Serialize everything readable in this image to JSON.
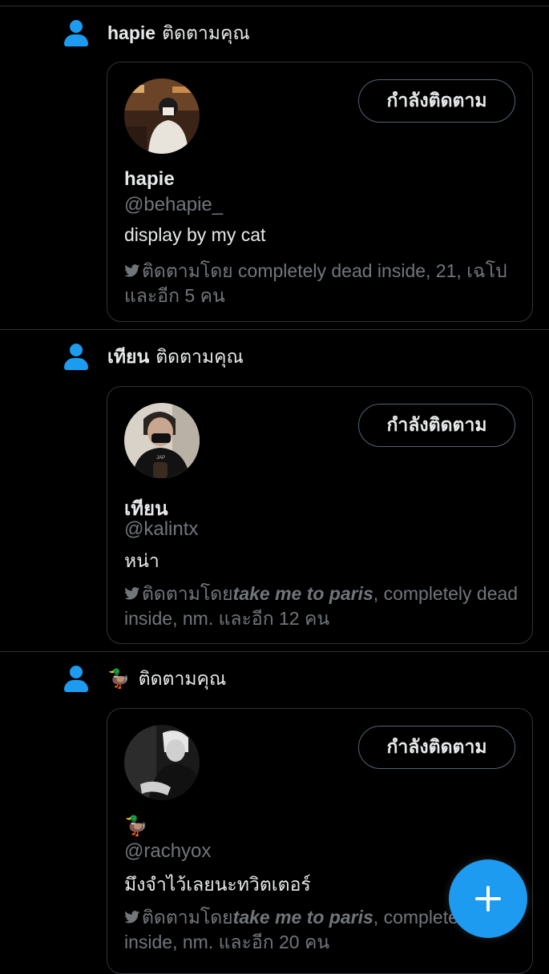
{
  "notifications": [
    {
      "actor_name": "hapie",
      "action_text": "ติดตามคุณ",
      "card": {
        "name": "hapie",
        "handle": "@behapie_",
        "bio": "display by my cat",
        "follow_button": "กำลังติดตาม",
        "followed_by_prefix": "ติดตามโดย",
        "followed_by_bold": "",
        "followed_by_rest": " completely dead inside, 21, เฉโป และอีก 5 คน"
      }
    },
    {
      "actor_name": "เทียน",
      "action_text": "ติดตามคุณ",
      "card": {
        "name": "เทียน",
        "handle": "@kalintx",
        "bio": "หน่า",
        "follow_button": "กำลังติดตาม",
        "followed_by_prefix": "ติดตามโดย",
        "followed_by_bold": "take me to paris",
        "followed_by_rest": ", completely dead inside, nm. และอีก 12 คน"
      }
    },
    {
      "actor_name": "🦆",
      "action_text": "ติดตามคุณ",
      "card": {
        "name": "🦆",
        "handle": "@rachyox",
        "bio": "มึงจำไว้เลยนะทวิตเตอร์",
        "follow_button": "กำลังติดตาม",
        "followed_by_prefix": "ติดตามโดย",
        "followed_by_bold": "take me to paris",
        "followed_by_rest": ", completely dead inside, nm. และอีก 20 คน"
      }
    }
  ],
  "icons": {
    "person": "person-icon",
    "bird": "twitter-bird-icon",
    "compose": "plus-icon"
  },
  "colors": {
    "accent": "#1d9bf0",
    "background": "#000000",
    "secondary_text": "#71767b",
    "border": "#2f3336"
  }
}
